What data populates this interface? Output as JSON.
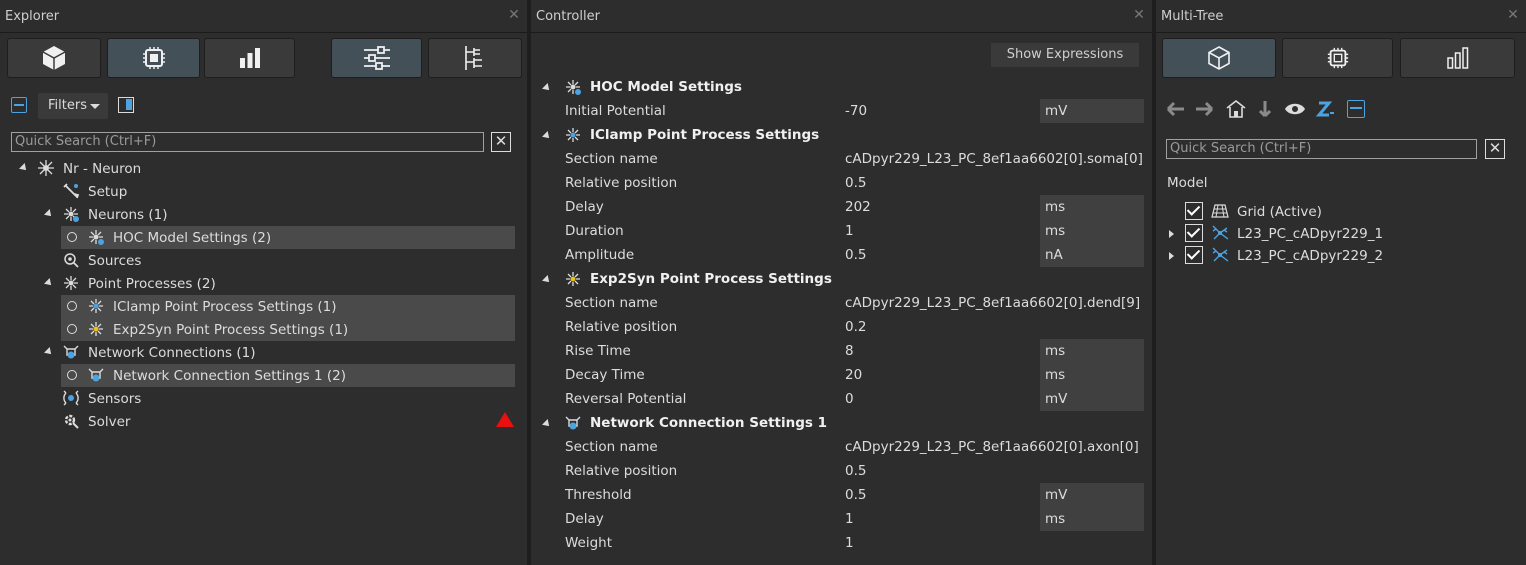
{
  "explorer": {
    "title": "Explorer",
    "toolbar": [
      {
        "icon": "cube-icon"
      },
      {
        "icon": "chip-icon"
      },
      {
        "icon": "bar-chart-icon"
      },
      {
        "icon": "sliders-icon"
      },
      {
        "icon": "hierarchy-icon"
      }
    ],
    "filters_label": "Filters",
    "search_placeholder": "Quick Search (Ctrl+F)",
    "tree": [
      {
        "label": "Nr - Neuron",
        "icon": "neuron-icon"
      },
      {
        "label": "Setup",
        "icon": "setup-icon"
      },
      {
        "label": "Neurons (1)",
        "icon": "neurons-icon"
      },
      {
        "label": "HOC Model Settings (2)",
        "icon": "hoc-settings-icon"
      },
      {
        "label": "Sources",
        "icon": "sources-icon"
      },
      {
        "label": "Point Processes (2)",
        "icon": "point-processes-icon"
      },
      {
        "label": "IClamp Point Process Settings (1)",
        "icon": "iclamp-icon"
      },
      {
        "label": "Exp2Syn Point Process Settings (1)",
        "icon": "exp2syn-icon"
      },
      {
        "label": "Network Connections (1)",
        "icon": "network-connections-icon"
      },
      {
        "label": "Network Connection Settings 1 (2)",
        "icon": "network-connection-settings-icon"
      },
      {
        "label": "Sensors",
        "icon": "sensors-icon"
      },
      {
        "label": "Solver",
        "icon": "solver-icon"
      }
    ]
  },
  "controller": {
    "title": "Controller",
    "show_expressions_label": "Show Expressions",
    "sections": [
      {
        "title": "HOC Model Settings",
        "rows": [
          {
            "name": "Initial Potential",
            "value": "-70",
            "unit": "mV"
          }
        ]
      },
      {
        "title": "IClamp Point Process Settings",
        "rows": [
          {
            "name": "Section name",
            "value": "cADpyr229_L23_PC_8ef1aa6602[0].soma[0]",
            "unit": ""
          },
          {
            "name": "Relative position",
            "value": "0.5",
            "unit": ""
          },
          {
            "name": "Delay",
            "value": "202",
            "unit": "ms"
          },
          {
            "name": "Duration",
            "value": "1",
            "unit": "ms"
          },
          {
            "name": "Amplitude",
            "value": "0.5",
            "unit": "nA"
          }
        ]
      },
      {
        "title": "Exp2Syn Point Process Settings",
        "rows": [
          {
            "name": "Section name",
            "value": "cADpyr229_L23_PC_8ef1aa6602[0].dend[9]",
            "unit": ""
          },
          {
            "name": "Relative position",
            "value": "0.2",
            "unit": ""
          },
          {
            "name": "Rise Time",
            "value": "8",
            "unit": "ms"
          },
          {
            "name": "Decay Time",
            "value": "20",
            "unit": "ms"
          },
          {
            "name": "Reversal Potential",
            "value": "0",
            "unit": "mV"
          }
        ]
      },
      {
        "title": "Network Connection Settings 1",
        "rows": [
          {
            "name": "Section name",
            "value": "cADpyr229_L23_PC_8ef1aa6602[0].axon[0]",
            "unit": ""
          },
          {
            "name": "Relative position",
            "value": "0.5",
            "unit": ""
          },
          {
            "name": "Threshold",
            "value": "0.5",
            "unit": "mV"
          },
          {
            "name": "Delay",
            "value": "1",
            "unit": "ms"
          },
          {
            "name": "Weight",
            "value": "1",
            "unit": ""
          }
        ]
      }
    ]
  },
  "multitree": {
    "title": "Multi-Tree",
    "search_placeholder": "Quick Search (Ctrl+F)",
    "model_label": "Model",
    "items": [
      {
        "label": "Grid (Active)",
        "checked": true
      },
      {
        "label": "L23_PC_cADpyr229_1",
        "checked": true
      },
      {
        "label": "L23_PC_cADpyr229_2",
        "checked": true
      }
    ]
  },
  "colors": {
    "accent": "#4da3e0",
    "warning": "#e81010",
    "panel_bg": "#2d2d2d",
    "selected_row": "#4a4a4a"
  }
}
